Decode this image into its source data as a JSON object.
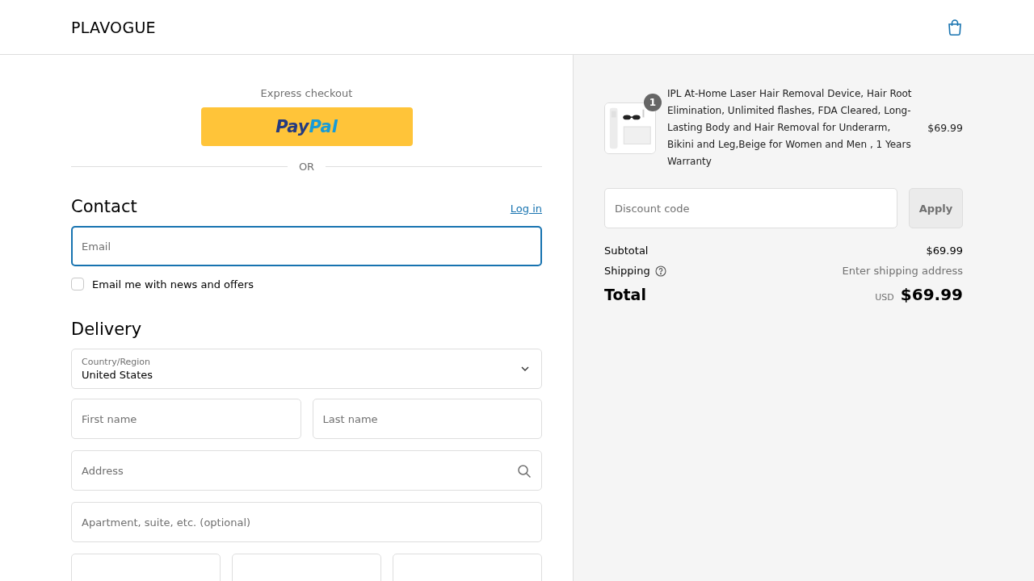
{
  "header": {
    "brand": "PLAVOGUE"
  },
  "express": {
    "label": "Express checkout",
    "paypal": [
      "Pay",
      "Pal"
    ],
    "divider": "OR"
  },
  "contact": {
    "title": "Contact",
    "login": "Log in",
    "email": {
      "placeholder": "Email",
      "focused": true
    },
    "newsletter": {
      "label": "Email me with news and offers",
      "checked": false
    }
  },
  "delivery": {
    "title": "Delivery",
    "country": {
      "label": "Country/Region",
      "value": "United States"
    },
    "rows": [
      [
        {
          "placeholder": "First name"
        },
        {
          "placeholder": "Last name"
        }
      ],
      [
        {
          "placeholder": "Address",
          "search": true
        }
      ],
      [
        {
          "placeholder": "Apartment, suite, etc. (optional)"
        }
      ],
      [
        {},
        {},
        {}
      ]
    ]
  },
  "summary": {
    "item": {
      "quantity": "1",
      "title": "IPL At-Home Laser Hair Removal Device, Hair Root Elimination, Unlimited flashes, FDA Cleared, Long-Lasting Body and Hair Removal for Underarm, Bikini and Leg,Beige for Women and Men , 1 Years Warranty",
      "price": "$69.99"
    },
    "discount": {
      "placeholder": "Discount code",
      "button": "Apply"
    },
    "subtotal": {
      "label": "Subtotal",
      "value": "$69.99"
    },
    "shipping": {
      "label": "Shipping",
      "value": "Enter shipping address"
    },
    "total": {
      "label": "Total",
      "currency": "USD",
      "value": "$69.99"
    }
  }
}
